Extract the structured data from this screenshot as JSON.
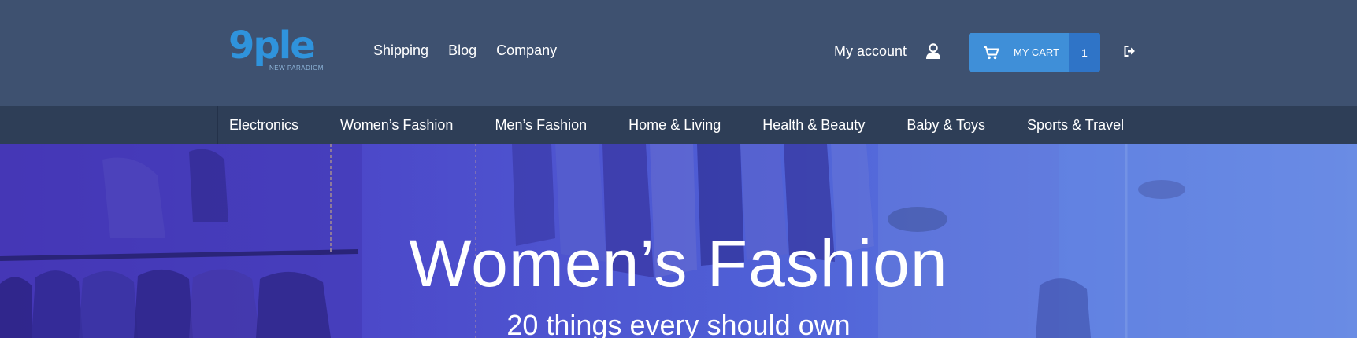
{
  "brand": {
    "logo_text": "9ple",
    "tagline": "NEW PARADIGM"
  },
  "top_nav": {
    "items": [
      "Shipping",
      "Blog",
      "Company"
    ]
  },
  "account": {
    "label": "My account",
    "icon": "user-icon"
  },
  "cart": {
    "label": "MY CART",
    "count": "1",
    "icon": "cart-icon"
  },
  "logout": {
    "icon": "logout-icon"
  },
  "categories": {
    "items": [
      "Electronics",
      "Women’s Fashion",
      "Men’s Fashion",
      "Home & Living",
      "Health & Beauty",
      "Baby & Toys",
      "Sports & Travel"
    ]
  },
  "hero": {
    "title": "Women’s Fashion",
    "subtitle": "20 things every should own"
  },
  "colors": {
    "header_bg": "#3e5170",
    "category_bar_bg": "#2e3e57",
    "cart_bg": "#3f8fd8",
    "cart_count_bg": "#2f74c7",
    "logo": "#2f93dc"
  }
}
